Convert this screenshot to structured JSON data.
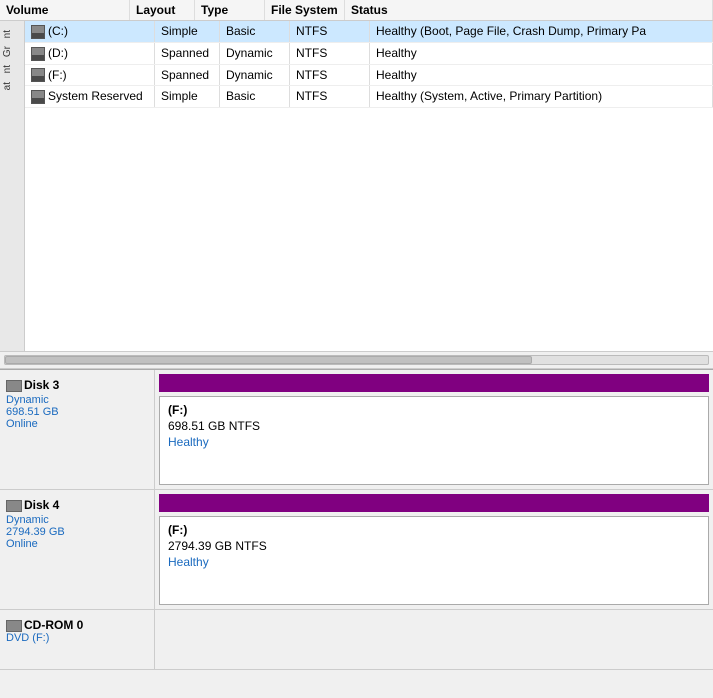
{
  "table": {
    "headers": [
      "Volume",
      "Layout",
      "Type",
      "File System",
      "Status"
    ],
    "rows": [
      {
        "volume": "(C:)",
        "layout": "Simple",
        "type": "Basic",
        "filesystem": "NTFS",
        "status": "Healthy (Boot, Page File, Crash Dump, Primary Pa",
        "selected": true
      },
      {
        "volume": "(D:)",
        "layout": "Spanned",
        "type": "Dynamic",
        "filesystem": "NTFS",
        "status": "Healthy",
        "selected": false
      },
      {
        "volume": "(F:)",
        "layout": "Spanned",
        "type": "Dynamic",
        "filesystem": "NTFS",
        "status": "Healthy",
        "selected": false
      },
      {
        "volume": "System Reserved",
        "layout": "Simple",
        "type": "Basic",
        "filesystem": "NTFS",
        "status": "Healthy (System, Active, Primary Partition)",
        "selected": false
      }
    ]
  },
  "left_nav": {
    "items": [
      "nt",
      "Gr",
      "nt",
      "at"
    ]
  },
  "disks": [
    {
      "id": "Disk 3",
      "type": "Dynamic",
      "size": "698.51 GB",
      "status": "Online",
      "partition_drive": "(F:)",
      "partition_info": "698.51 GB NTFS",
      "partition_status": "Healthy"
    },
    {
      "id": "Disk 4",
      "type": "Dynamic",
      "size": "2794.39 GB",
      "status": "Online",
      "partition_drive": "(F:)",
      "partition_info": "2794.39 GB NTFS",
      "partition_status": "Healthy"
    }
  ],
  "cdrom": {
    "id": "CD-ROM 0",
    "drive": "DVD (F:)"
  }
}
